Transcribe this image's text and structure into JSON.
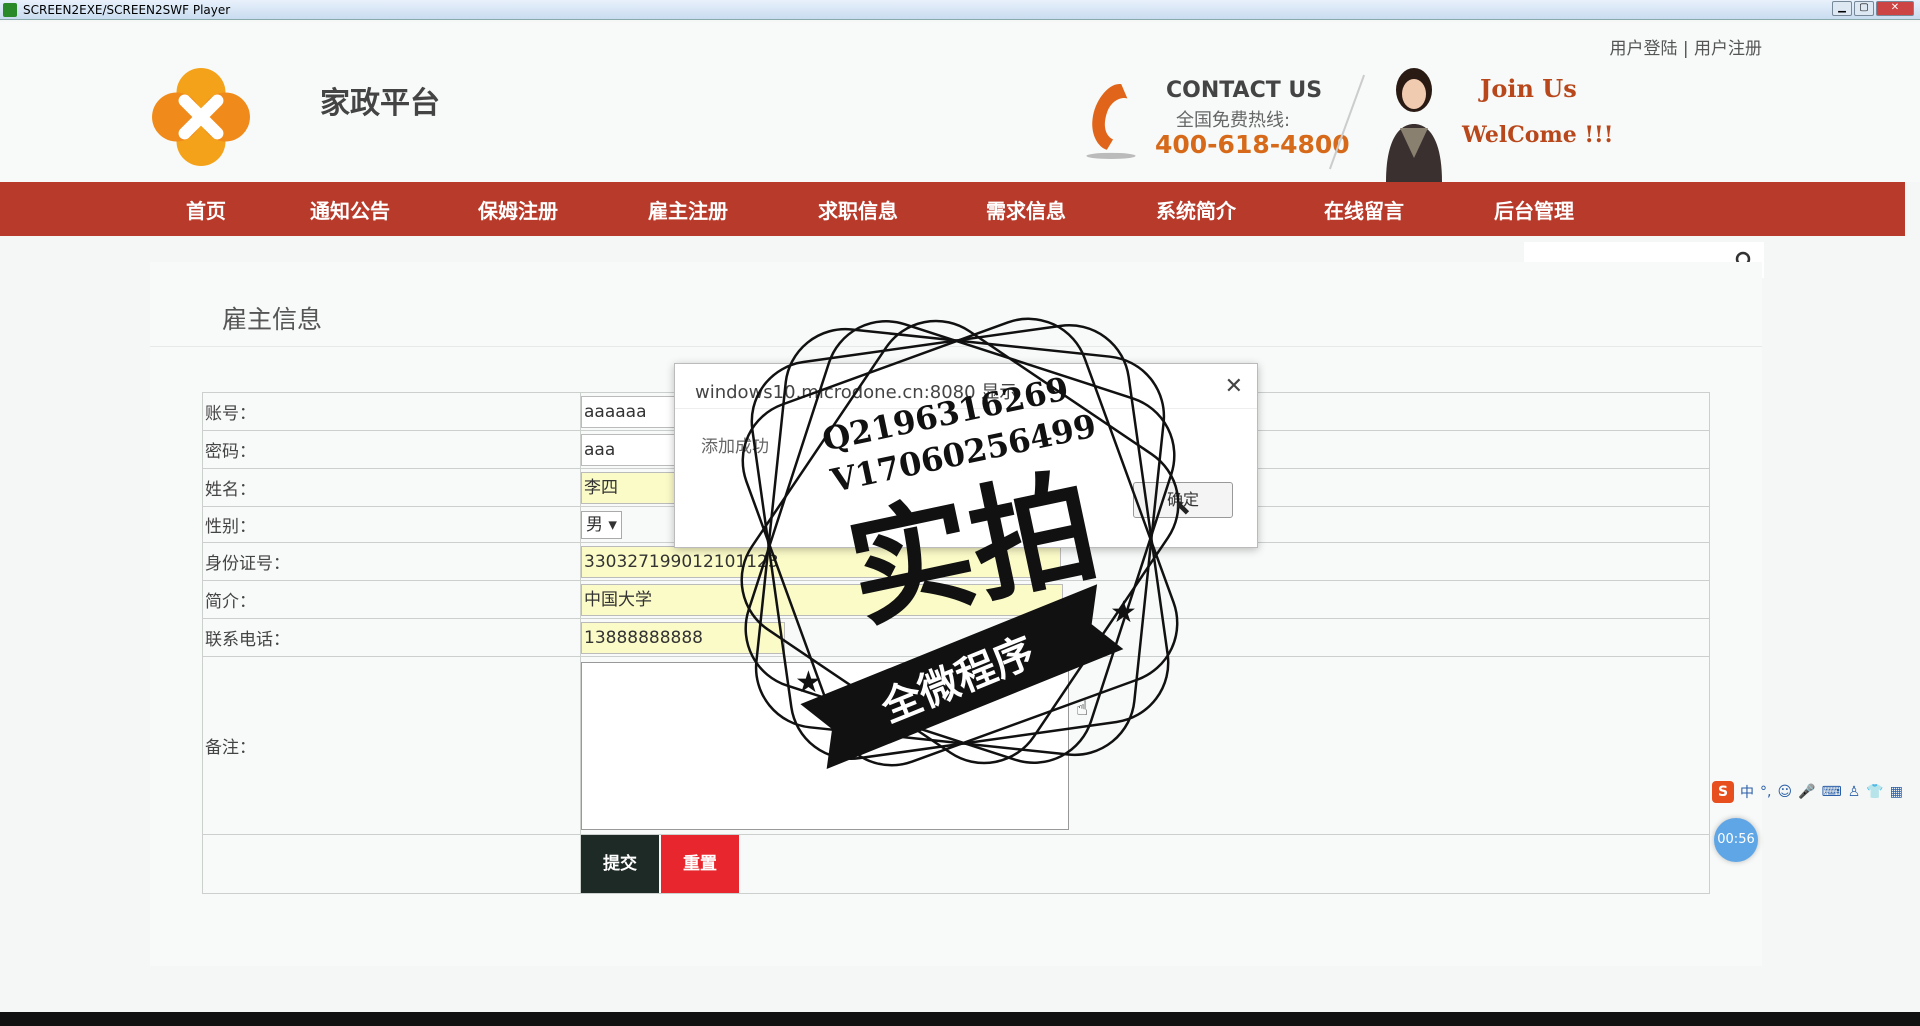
{
  "window": {
    "title": "SCREEN2EXE/SCREEN2SWF Player"
  },
  "header": {
    "login": "用户登陆",
    "sep": "|",
    "register": "用户注册",
    "site_name": "家政平台",
    "contact_title": "CONTACT US",
    "contact_sub": "全国免费热线:",
    "contact_phone": "400-618-4800",
    "join_us": "Join Us",
    "welcome": "WelCome !!!"
  },
  "nav": {
    "items": [
      "首页",
      "通知公告",
      "保姆注册",
      "雇主注册",
      "求职信息",
      "需求信息",
      "系统简介",
      "在线留言",
      "后台管理"
    ]
  },
  "panel": {
    "title": "雇主信息"
  },
  "form": {
    "account_label": "账号：",
    "account_value": "aaaaaa",
    "password_label": "密码：",
    "password_value": "aaa",
    "name_label": "姓名：",
    "name_value": "李四",
    "gender_label": "性别：",
    "gender_value": "男",
    "idcard_label": "身份证号：",
    "idcard_value": "330327199012101123",
    "intro_label": "简介：",
    "intro_value": "中国大学",
    "phone_label": "联系电话：",
    "phone_value": "13888888888",
    "remark_label": "备注：",
    "submit": "提交",
    "reset": "重置"
  },
  "dialog": {
    "title": "windows10.microdone.cn:8080 显示",
    "message": "添加成功",
    "ok": "确定",
    "close": "✕"
  },
  "watermark": {
    "line1": "Q2196316269",
    "line2": "V17060256499",
    "big": "实拍",
    "ribbon": "全微程序"
  },
  "ime": {
    "label": "中"
  },
  "timer": {
    "value": "00:56"
  },
  "colors": {
    "nav": "#b83a2b",
    "accent": "#d66a1a",
    "submit": "#1e2a26",
    "reset": "#e8262d"
  }
}
